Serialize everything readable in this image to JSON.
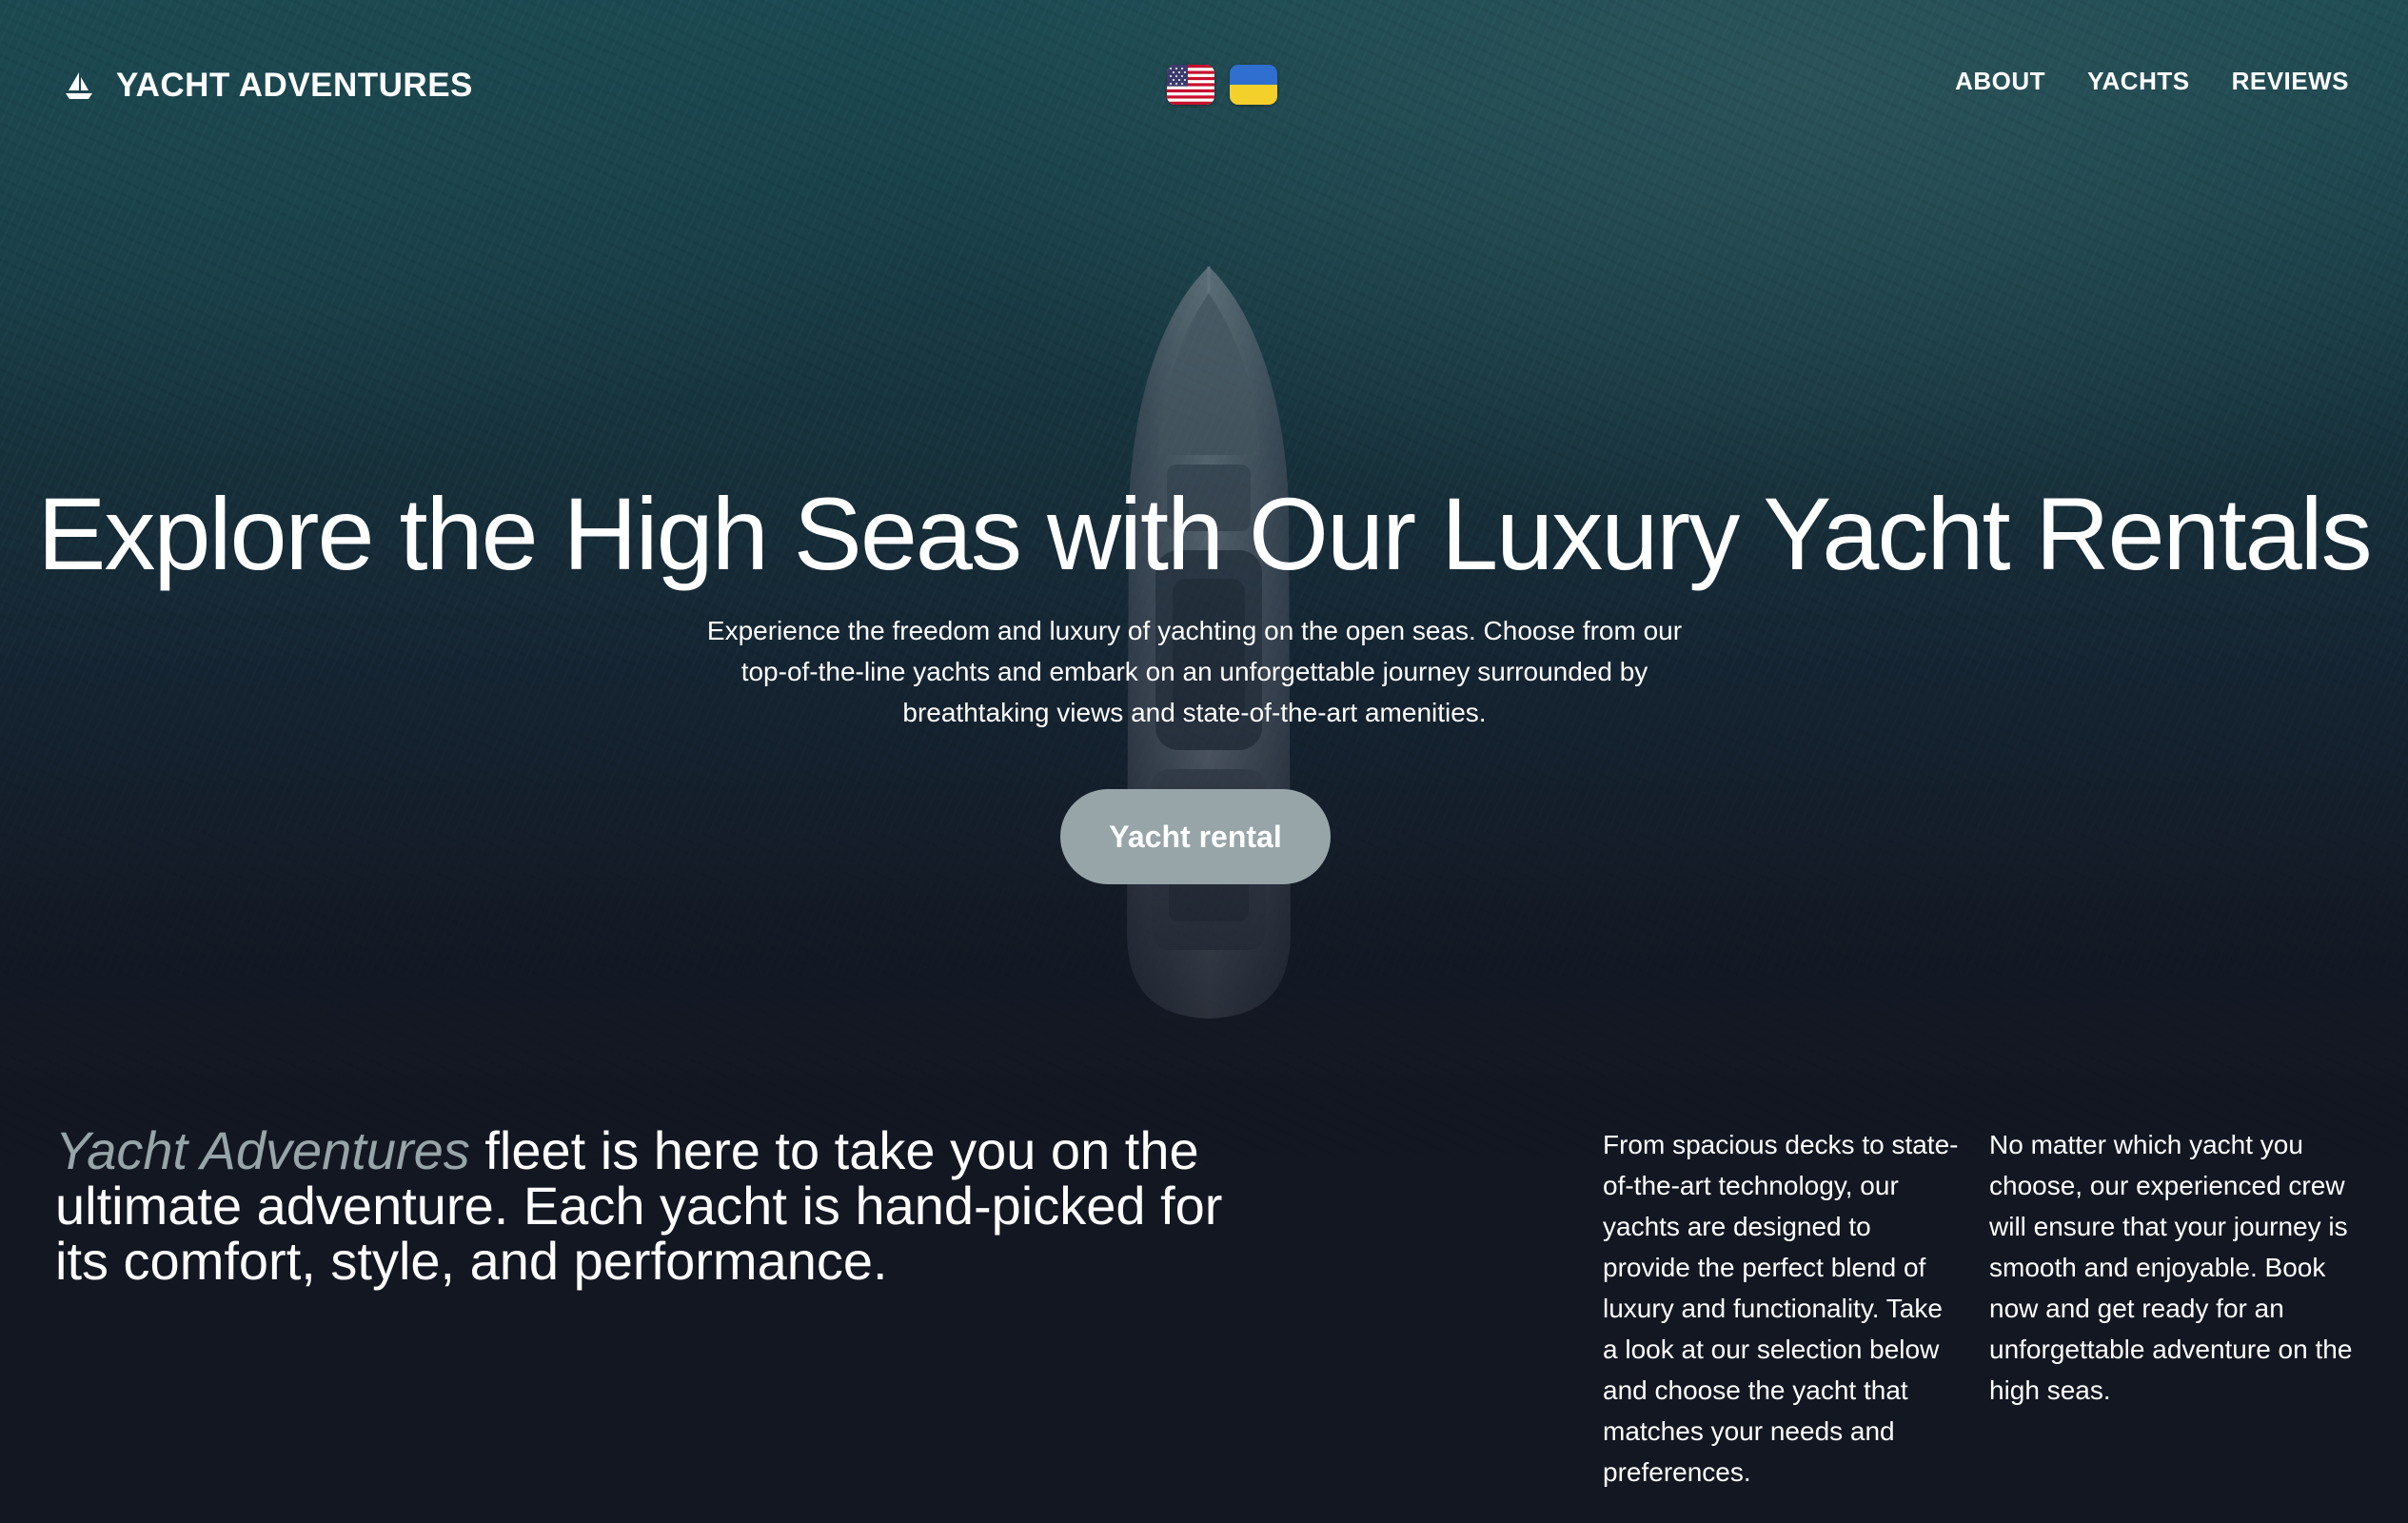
{
  "header": {
    "brand_name": "YACHT ADVENTURES",
    "brand_icon": "sailboat-icon",
    "languages": [
      {
        "code": "en",
        "icon": "us-flag-icon"
      },
      {
        "code": "uk",
        "icon": "ukraine-flag-icon"
      }
    ],
    "nav": [
      {
        "label": "ABOUT"
      },
      {
        "label": "YACHTS"
      },
      {
        "label": "REVIEWS"
      }
    ]
  },
  "hero": {
    "title": "Explore the High Seas with Our Luxury Yacht Rentals",
    "subtitle": "Experience the freedom and luxury of yachting on the open seas. Choose from our top-of-the-line yachts and embark on an unforgettable journey surrounded by breathtaking views and state-of-the-art amenities.",
    "cta_label": "Yacht rental"
  },
  "fleet": {
    "lead_brand": "Yacht Adventures",
    "lead_text": " fleet is here to take you on the ultimate adventure. Each yacht is hand-picked for its comfort, style, and performance.",
    "col1": "From spacious decks to state-of-the-art technology, our yachts are designed to provide the perfect blend of luxury and functionality. Take a look at our selection below and choose the yacht that matches your needs and preferences.",
    "col2": "No matter which yacht you choose, our experienced crew will ensure that your journey is smooth and enjoyable. Book now and get ready for an unforgettable adventure on the high seas."
  },
  "colors": {
    "background": "#131722",
    "ocean": "#1b4a52",
    "accent": "#97a4a8",
    "text": "#ffffff"
  }
}
